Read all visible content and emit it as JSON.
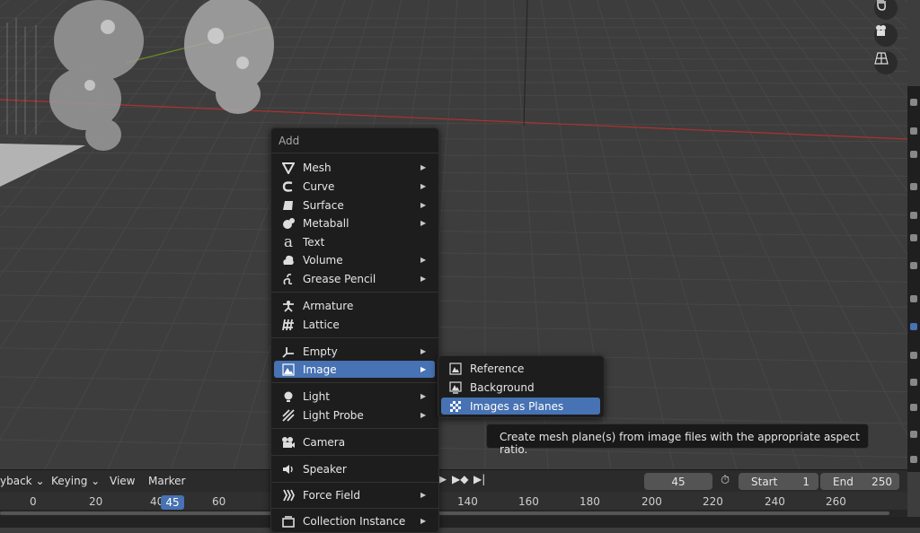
{
  "add_menu": {
    "title": "Add",
    "items": [
      {
        "label": "Mesh",
        "icon": "mesh-icon",
        "submenu": true
      },
      {
        "label": "Curve",
        "icon": "curve-icon",
        "submenu": true
      },
      {
        "label": "Surface",
        "icon": "surface-icon",
        "submenu": true
      },
      {
        "label": "Metaball",
        "icon": "metaball-icon",
        "submenu": true
      },
      {
        "label": "Text",
        "icon": "text-icon",
        "submenu": false
      },
      {
        "label": "Volume",
        "icon": "volume-icon",
        "submenu": true
      },
      {
        "label": "Grease Pencil",
        "icon": "grease-pencil-icon",
        "submenu": true
      },
      {
        "label": "Armature",
        "icon": "armature-icon",
        "submenu": false
      },
      {
        "label": "Lattice",
        "icon": "lattice-icon",
        "submenu": false
      },
      {
        "label": "Empty",
        "icon": "empty-icon",
        "submenu": true
      },
      {
        "label": "Image",
        "icon": "image-icon",
        "submenu": true,
        "active": true
      },
      {
        "label": "Light",
        "icon": "light-icon",
        "submenu": true
      },
      {
        "label": "Light Probe",
        "icon": "light-probe-icon",
        "submenu": true
      },
      {
        "label": "Camera",
        "icon": "camera-icon",
        "submenu": false
      },
      {
        "label": "Speaker",
        "icon": "speaker-icon",
        "submenu": false
      },
      {
        "label": "Force Field",
        "icon": "force-field-icon",
        "submenu": true
      },
      {
        "label": "Collection Instance",
        "icon": "collection-icon",
        "submenu": true
      }
    ]
  },
  "image_submenu": {
    "items": [
      {
        "label": "Reference",
        "icon": "reference-image-icon"
      },
      {
        "label": "Background",
        "icon": "background-image-icon"
      },
      {
        "label": "Images as Planes",
        "icon": "images-as-planes-icon",
        "active": true
      }
    ]
  },
  "tooltip": {
    "text": "Create mesh plane(s) from image files with the appropriate aspect ratio."
  },
  "timeline": {
    "menus": {
      "playback": "yback",
      "keying": "Keying",
      "view": "View",
      "marker": "Marker"
    },
    "current_frame": "45",
    "start_label": "Start",
    "start_value": "1",
    "end_label": "End",
    "end_value": "250",
    "ruler_left": [
      "0",
      "20",
      "40",
      "60"
    ],
    "ruler_right": [
      "140",
      "160",
      "180",
      "200",
      "220",
      "240",
      "260"
    ],
    "indicator": "45"
  },
  "colors": {
    "accent": "#4772b3",
    "viewport_bg": "#3d3d3d",
    "menu_bg": "#1d1d1d",
    "x_axis": "#b03030",
    "y_axis": "#6b8a2a"
  }
}
